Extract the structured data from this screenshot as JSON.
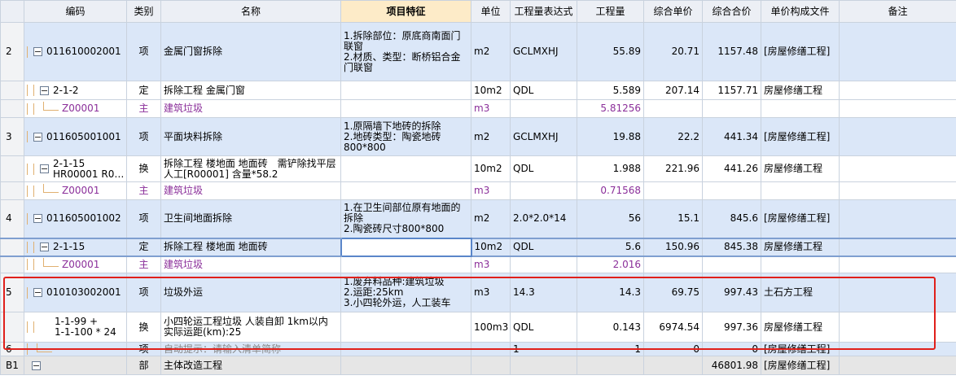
{
  "columns": {
    "code": "编码",
    "type": "类别",
    "name": "名称",
    "feature": "项目特征",
    "unit": "单位",
    "expr": "工程量表达式",
    "qty": "工程量",
    "uprice": "综合单价",
    "total": "综合合价",
    "file": "单价构成文件",
    "remark": "备注"
  },
  "rows": {
    "r1": {
      "idx": "2",
      "code": "011610002001",
      "type": "项",
      "name": "金属门窗拆除",
      "feature": "1.拆除部位：原底商南面门联窗\n2.材质、类型：断桥铝合金门联窗",
      "unit": "m2",
      "expr": "GCLMXHJ",
      "qty": "55.89",
      "uprice": "20.71",
      "total": "1157.48",
      "file": "[房屋修缮工程]"
    },
    "r2": {
      "code": "2-1-2",
      "type": "定",
      "name": "拆除工程 金属门窗",
      "unit": "10m2",
      "expr": "QDL",
      "qty": "5.589",
      "uprice": "207.14",
      "total": "1157.71",
      "file": "房屋修缮工程"
    },
    "r3": {
      "code": "Z00001",
      "type": "主",
      "name": "建筑垃圾",
      "unit": "m3",
      "qty": "5.81256"
    },
    "r4": {
      "idx": "3",
      "code": "011605001001",
      "type": "项",
      "name": "平面块料拆除",
      "feature": "1.原隔墙下地砖的拆除\n2.地砖类型：陶瓷地砖800*800",
      "unit": "m2",
      "expr": "GCLMXHJ",
      "qty": "19.88",
      "uprice": "22.2",
      "total": "441.34",
      "file": "[房屋修缮工程]"
    },
    "r5": {
      "code1": "2-1-15",
      "code2": "HR00001 R0…",
      "type": "换",
      "name": "拆除工程 楼地面 地面砖　需铲除找平层 人工[R00001] 含量*58.2",
      "unit": "10m2",
      "expr": "QDL",
      "qty": "1.988",
      "uprice": "221.96",
      "total": "441.26",
      "file": "房屋修缮工程"
    },
    "r6": {
      "code": "Z00001",
      "type": "主",
      "name": "建筑垃圾",
      "unit": "m3",
      "qty": "0.71568"
    },
    "r7": {
      "idx": "4",
      "code": "011605001002",
      "type": "项",
      "name": "卫生间地面拆除",
      "feature": "1.在卫生间部位原有地面的拆除\n2.陶瓷砖尺寸800*800",
      "unit": "m2",
      "expr": "2.0*2.0*14",
      "qty": "56",
      "uprice": "15.1",
      "total": "845.6",
      "file": "[房屋修缮工程]"
    },
    "r8": {
      "code": "2-1-15",
      "type": "定",
      "name": "拆除工程 楼地面 地面砖",
      "unit": "10m2",
      "expr": "QDL",
      "qty": "5.6",
      "uprice": "150.96",
      "total": "845.38",
      "file": "房屋修缮工程"
    },
    "r9": {
      "code": "Z00001",
      "type": "主",
      "name": "建筑垃圾",
      "unit": "m3",
      "qty": "2.016"
    },
    "r10": {
      "idx": "5",
      "code": "010103002001",
      "type": "项",
      "name": "垃圾外运",
      "feature": "1.废弃料品种:建筑垃圾\n2.运距:25km\n3.小四轮外运，人工装车",
      "unit": "m3",
      "expr": "14.3",
      "qty": "14.3",
      "uprice": "69.75",
      "total": "997.43",
      "file": "土石方工程"
    },
    "r11": {
      "code1": "1-1-99 +",
      "code2": "1-1-100 * 24",
      "type": "换",
      "name": "小四轮运工程垃圾 人装自卸 1km以内\n实际运距(km):25",
      "unit": "100m3",
      "expr": "QDL",
      "qty": "0.143",
      "uprice": "6974.54",
      "total": "997.36",
      "file": "房屋修缮工程"
    },
    "r12": {
      "idx": "6",
      "type": "项",
      "name": "自动提示：请输入清单简称",
      "expr": "1",
      "qty": "1",
      "uprice": "0",
      "total": "0",
      "file": "[房屋修缮工程]"
    },
    "r13": {
      "idx": "B1",
      "type": "部",
      "name": "主体改造工程",
      "total": "46801.98",
      "file": "[房屋修缮工程]"
    }
  }
}
